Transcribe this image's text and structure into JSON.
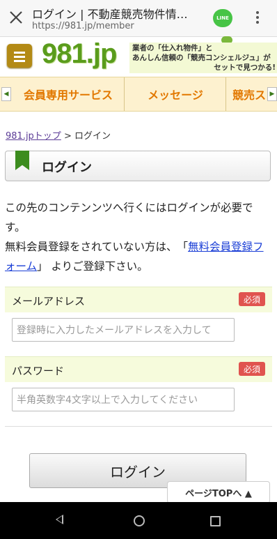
{
  "browser": {
    "tab_title": "ログイン | 不動産競売物件情…",
    "url": "https://981.jp/member",
    "line_label": "LINE"
  },
  "site": {
    "logo_text": "981.jp",
    "tagline_line1": "業者の「仕入れ物件」と",
    "tagline_line2": "あんしん信頼の「競売コンシェルジュ」が",
    "tagline_line3": "セットで見つかる!",
    "brand_color": "#5a9c1c"
  },
  "nav": {
    "items": [
      "会員専用サービス",
      "メッセージ",
      "競売ス"
    ]
  },
  "breadcrumb": {
    "home_link": "981.jpトップ",
    "separator": " > ",
    "current": "ログイン"
  },
  "page": {
    "title": "ログイン",
    "intro_line1": "この先のコンテンンツへ行くにはログインが必要です。",
    "intro_line2_prefix": "無料会員登録をされていない方は、　「",
    "intro_link": "無料会員登録フォーム",
    "intro_line2_suffix": "」 よりご登録下さい。"
  },
  "form": {
    "email_label": "メールアドレス",
    "email_required": "必須",
    "email_placeholder": "登録時に入力したメールアドレスを入力して",
    "password_label": "パスワード",
    "password_required": "必須",
    "password_placeholder": "半角英数字4文字以上で入力してください",
    "submit_label": "ログイン"
  },
  "page_top_label": "ページTOPへ ▲"
}
